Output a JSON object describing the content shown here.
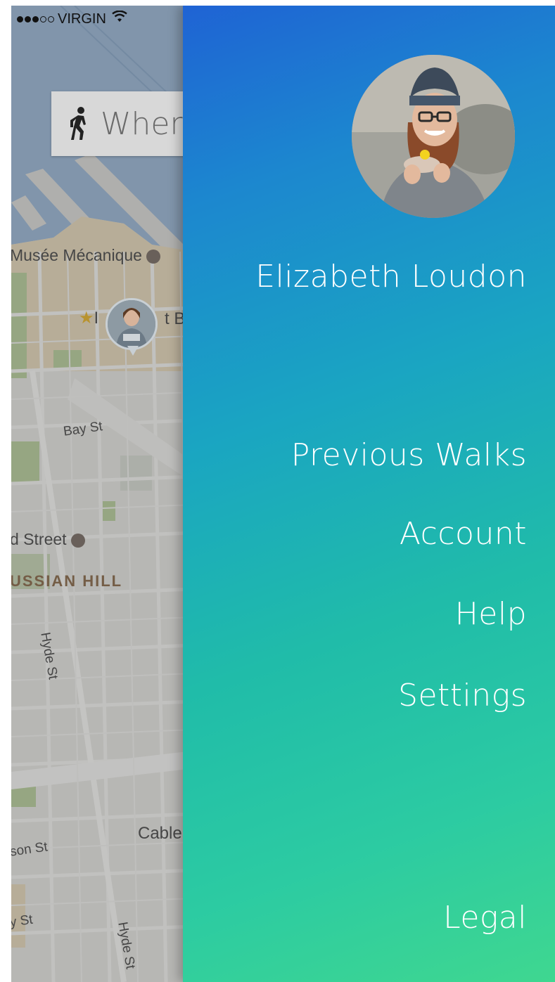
{
  "status_bar": {
    "carrier": "VIRGIN",
    "signal_filled": 3,
    "signal_total": 5
  },
  "search": {
    "placeholder": "Where",
    "icon": "walking-person-icon"
  },
  "map": {
    "labels": {
      "museum": "Musée Mécanique",
      "poi_partial": "I",
      "poi_partial_end": "t B",
      "bay_st": "Bay St",
      "street_partial": "d Street",
      "russian_hill": "USSIAN HILL",
      "hyde_st_1": "Hyde St",
      "cable": "Cable",
      "son_st": "son St",
      "y_st": "y St",
      "hyde_st_2": "Hyde St"
    }
  },
  "drawer": {
    "user_name": "Elizabeth Loudon",
    "menu": [
      {
        "label": "Previous Walks"
      },
      {
        "label": "Account"
      },
      {
        "label": "Help"
      },
      {
        "label": "Settings"
      }
    ],
    "footer": {
      "label": "Legal"
    }
  },
  "colors": {
    "gradient_top": "#1f63d4",
    "gradient_bottom": "#3fd790",
    "text": "#ffffff"
  }
}
